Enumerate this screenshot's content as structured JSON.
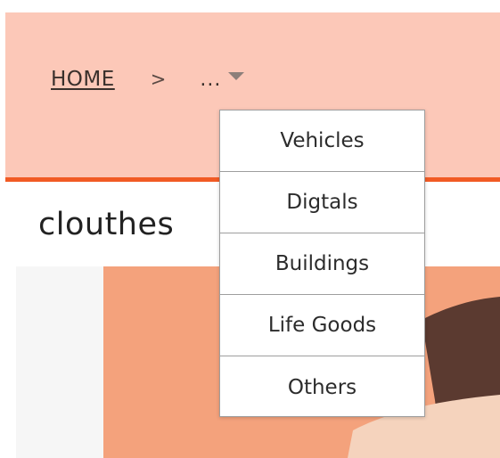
{
  "breadcrumb": {
    "home_label": "HOME",
    "separator": ">",
    "more_label": "..."
  },
  "page": {
    "title": "clouthes"
  },
  "dropdown": {
    "items": [
      {
        "label": "Vehicles"
      },
      {
        "label": "Digtals"
      },
      {
        "label": "Buildings"
      },
      {
        "label": "Life Goods"
      },
      {
        "label": "Others"
      }
    ]
  },
  "colors": {
    "header_background": "#fcc8b8",
    "accent_line": "#f15a24",
    "image_orange": "#f4a27c",
    "image_dark": "#5b3a30",
    "image_light": "#f5d3bd"
  }
}
